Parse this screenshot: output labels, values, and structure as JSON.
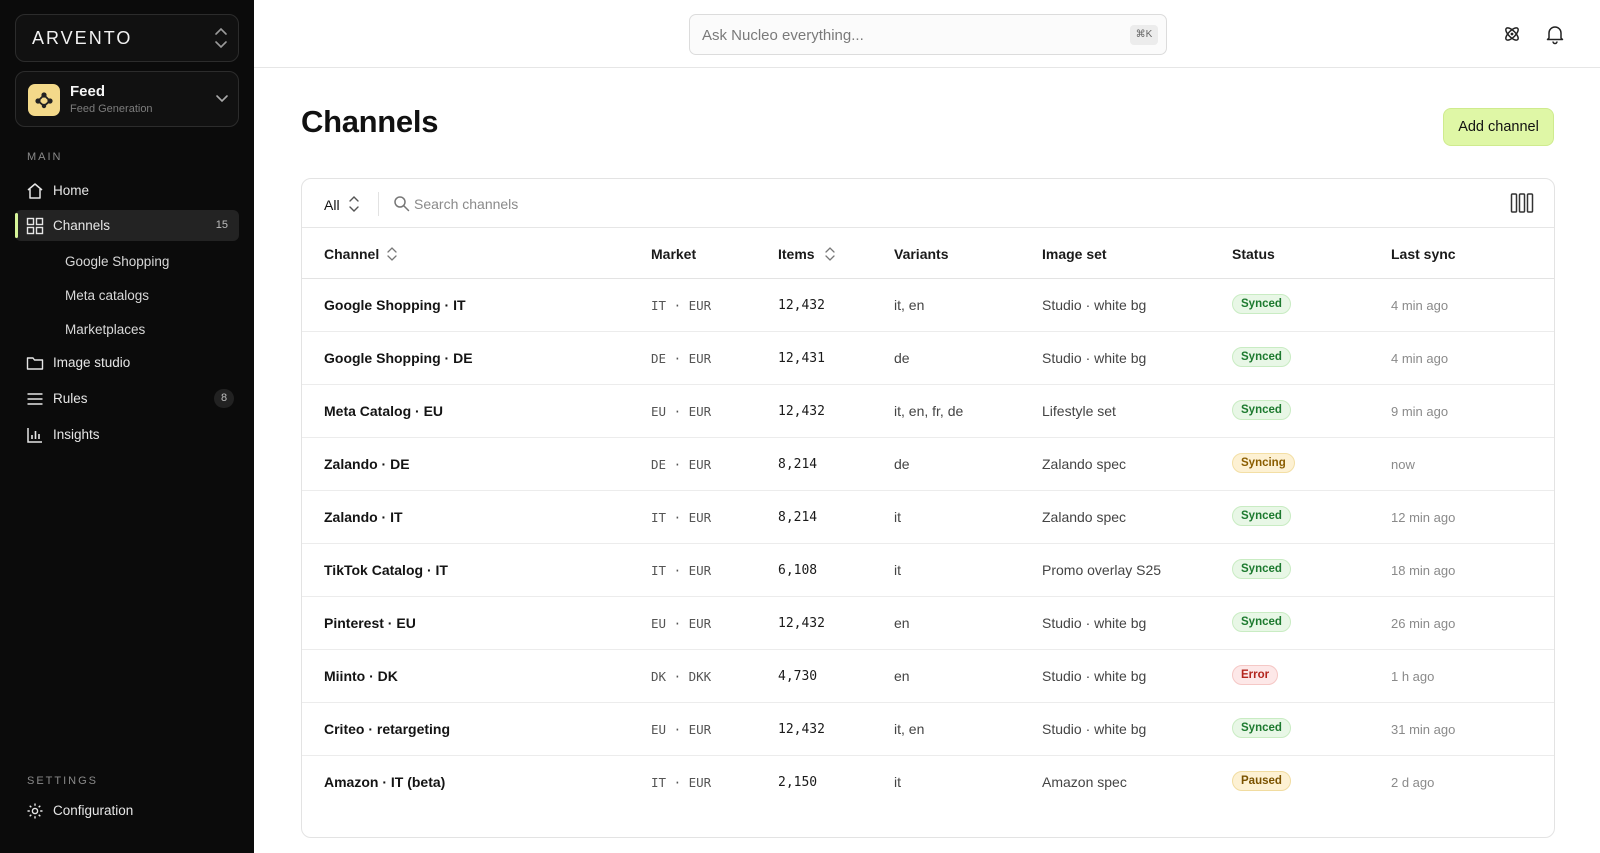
{
  "brand": {
    "name": "ARVENTO"
  },
  "workspace": {
    "title": "Feed",
    "subtitle": "Feed Generation"
  },
  "sidebar": {
    "main_label": "MAIN",
    "settings_label": "SETTINGS",
    "home": "Home",
    "channels": {
      "label": "Channels",
      "count": "15"
    },
    "subitems": [
      "Google Shopping",
      "Meta catalogs",
      "Marketplaces"
    ],
    "image_studio": "Image studio",
    "rules": {
      "label": "Rules",
      "count": "8"
    },
    "insights": "Insights",
    "configuration": "Configuration"
  },
  "topbar": {
    "search_placeholder": "Ask Nucleo everything...",
    "shortcut": "⌘K"
  },
  "page": {
    "title": "Channels",
    "add_button": "Add channel"
  },
  "filters": {
    "selected": "All",
    "search_placeholder": "Search channels"
  },
  "table": {
    "headers": {
      "channel": "Channel",
      "market": "Market",
      "items": "Items",
      "variants": "Variants",
      "image_set": "Image set",
      "status": "Status",
      "last_sync": "Last sync"
    },
    "rows": [
      {
        "channel": "Google Shopping · IT",
        "market": "IT · EUR",
        "items": "12,432",
        "variants": "it, en",
        "image_set": "Studio · white bg",
        "status": "Synced",
        "last_sync": "4 min ago"
      },
      {
        "channel": "Google Shopping · DE",
        "market": "DE · EUR",
        "items": "12,431",
        "variants": "de",
        "image_set": "Studio · white bg",
        "status": "Synced",
        "last_sync": "4 min ago"
      },
      {
        "channel": "Meta Catalog · EU",
        "market": "EU · EUR",
        "items": "12,432",
        "variants": "it, en, fr, de",
        "image_set": "Lifestyle set",
        "status": "Synced",
        "last_sync": "9 min ago"
      },
      {
        "channel": "Zalando · DE",
        "market": "DE · EUR",
        "items": "8,214",
        "variants": "de",
        "image_set": "Zalando spec",
        "status": "Syncing",
        "last_sync": "now"
      },
      {
        "channel": "Zalando · IT",
        "market": "IT · EUR",
        "items": "8,214",
        "variants": "it",
        "image_set": "Zalando spec",
        "status": "Synced",
        "last_sync": "12 min ago"
      },
      {
        "channel": "TikTok Catalog · IT",
        "market": "IT · EUR",
        "items": "6,108",
        "variants": "it",
        "image_set": "Promo overlay S25",
        "status": "Synced",
        "last_sync": "18 min ago"
      },
      {
        "channel": "Pinterest · EU",
        "market": "EU · EUR",
        "items": "12,432",
        "variants": "en",
        "image_set": "Studio · white bg",
        "status": "Synced",
        "last_sync": "26 min ago"
      },
      {
        "channel": "Miinto · DK",
        "market": "DK · DKK",
        "items": "4,730",
        "variants": "en",
        "image_set": "Studio · white bg",
        "status": "Error",
        "last_sync": "1 h ago"
      },
      {
        "channel": "Criteo · retargeting",
        "market": "EU · EUR",
        "items": "12,432",
        "variants": "it, en",
        "image_set": "Studio · white bg",
        "status": "Synced",
        "last_sync": "31 min ago"
      },
      {
        "channel": "Amazon · IT (beta)",
        "market": "IT · EUR",
        "items": "2,150",
        "variants": "it",
        "image_set": "Amazon spec",
        "status": "Paused",
        "last_sync": "2 d ago"
      }
    ]
  },
  "colors": {
    "sidebar_bg": "#0b0b0b",
    "accent": "#dff7a6",
    "synced": "#1d7a2f",
    "syncing": "#8a5d00",
    "error": "#b3261e",
    "paused": "#7a5200"
  },
  "icons": {
    "brand_switch": "chevron-up-down-icon",
    "workspace_logo": "nodes-icon",
    "home": "home-icon",
    "channels": "grid-icon",
    "image_studio": "folder-icon",
    "rules": "menu-icon",
    "insights": "bar-chart-icon",
    "configuration": "gear-icon",
    "ai": "atom-icon",
    "notifications": "bell-icon",
    "search": "search-icon",
    "columns": "columns-icon"
  }
}
